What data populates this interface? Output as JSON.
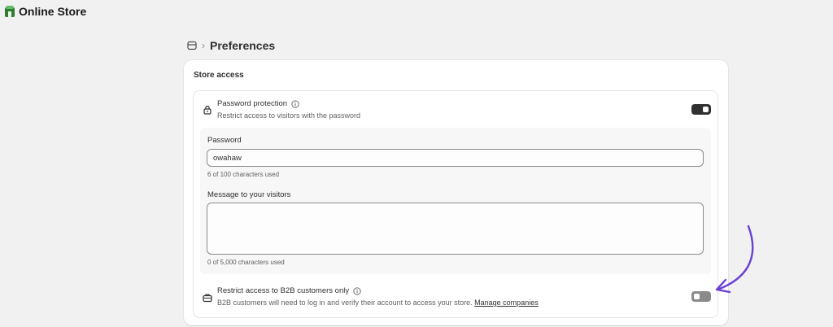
{
  "app": {
    "title": "Online Store",
    "icon": "store-icon",
    "brand_color": "#2e7d32"
  },
  "breadcrumb": {
    "icon": "online-store-icon",
    "separator": "›",
    "page_title": "Preferences"
  },
  "store_access": {
    "section_title": "Store access",
    "password_protection": {
      "title": "Password protection",
      "description": "Restrict access to visitors with the password",
      "icon": "lock-icon",
      "enabled": true
    },
    "password": {
      "label": "Password",
      "value": "owahaw",
      "help": "6 of 100 characters used"
    },
    "message": {
      "label": "Message to your visitors",
      "value": "",
      "help": "0 of 5,000 characters used"
    },
    "b2b": {
      "title": "Restrict access to B2B customers only",
      "description": "B2B customers will need to log in and verify their account to access your store.",
      "link_text": "Manage companies",
      "icon": "briefcase-icon",
      "enabled": false
    }
  },
  "annotation": {
    "arrow_color": "#6a3fd4"
  }
}
